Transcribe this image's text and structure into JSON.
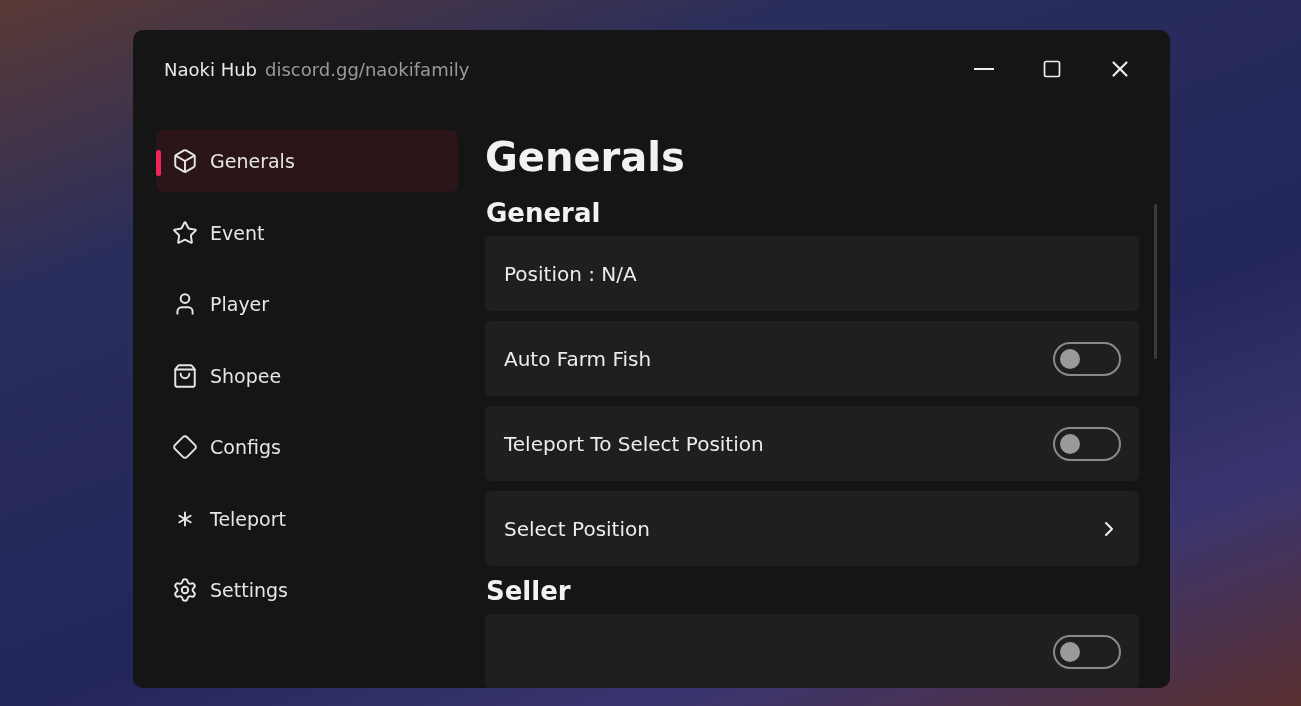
{
  "window": {
    "title": "Naoki Hub",
    "subtitle": "discord.gg/naokifamily"
  },
  "sidebar": {
    "items": [
      {
        "label": "Generals",
        "selected": true
      },
      {
        "label": "Event",
        "selected": false
      },
      {
        "label": "Player",
        "selected": false
      },
      {
        "label": "Shopee",
        "selected": false
      },
      {
        "label": "Configs",
        "selected": false
      },
      {
        "label": "Teleport",
        "selected": false
      },
      {
        "label": "Settings",
        "selected": false
      }
    ]
  },
  "page": {
    "title": "Generals",
    "sections": [
      {
        "title": "General",
        "rows": [
          {
            "kind": "label",
            "label": "Position : N/A"
          },
          {
            "kind": "toggle",
            "label": "Auto Farm Fish",
            "on": false
          },
          {
            "kind": "toggle",
            "label": "Teleport To Select Position",
            "on": false
          },
          {
            "kind": "dropdown",
            "label": "Select Position"
          }
        ]
      },
      {
        "title": "Seller",
        "rows": [
          {
            "kind": "toggle",
            "on": false
          }
        ]
      }
    ]
  }
}
